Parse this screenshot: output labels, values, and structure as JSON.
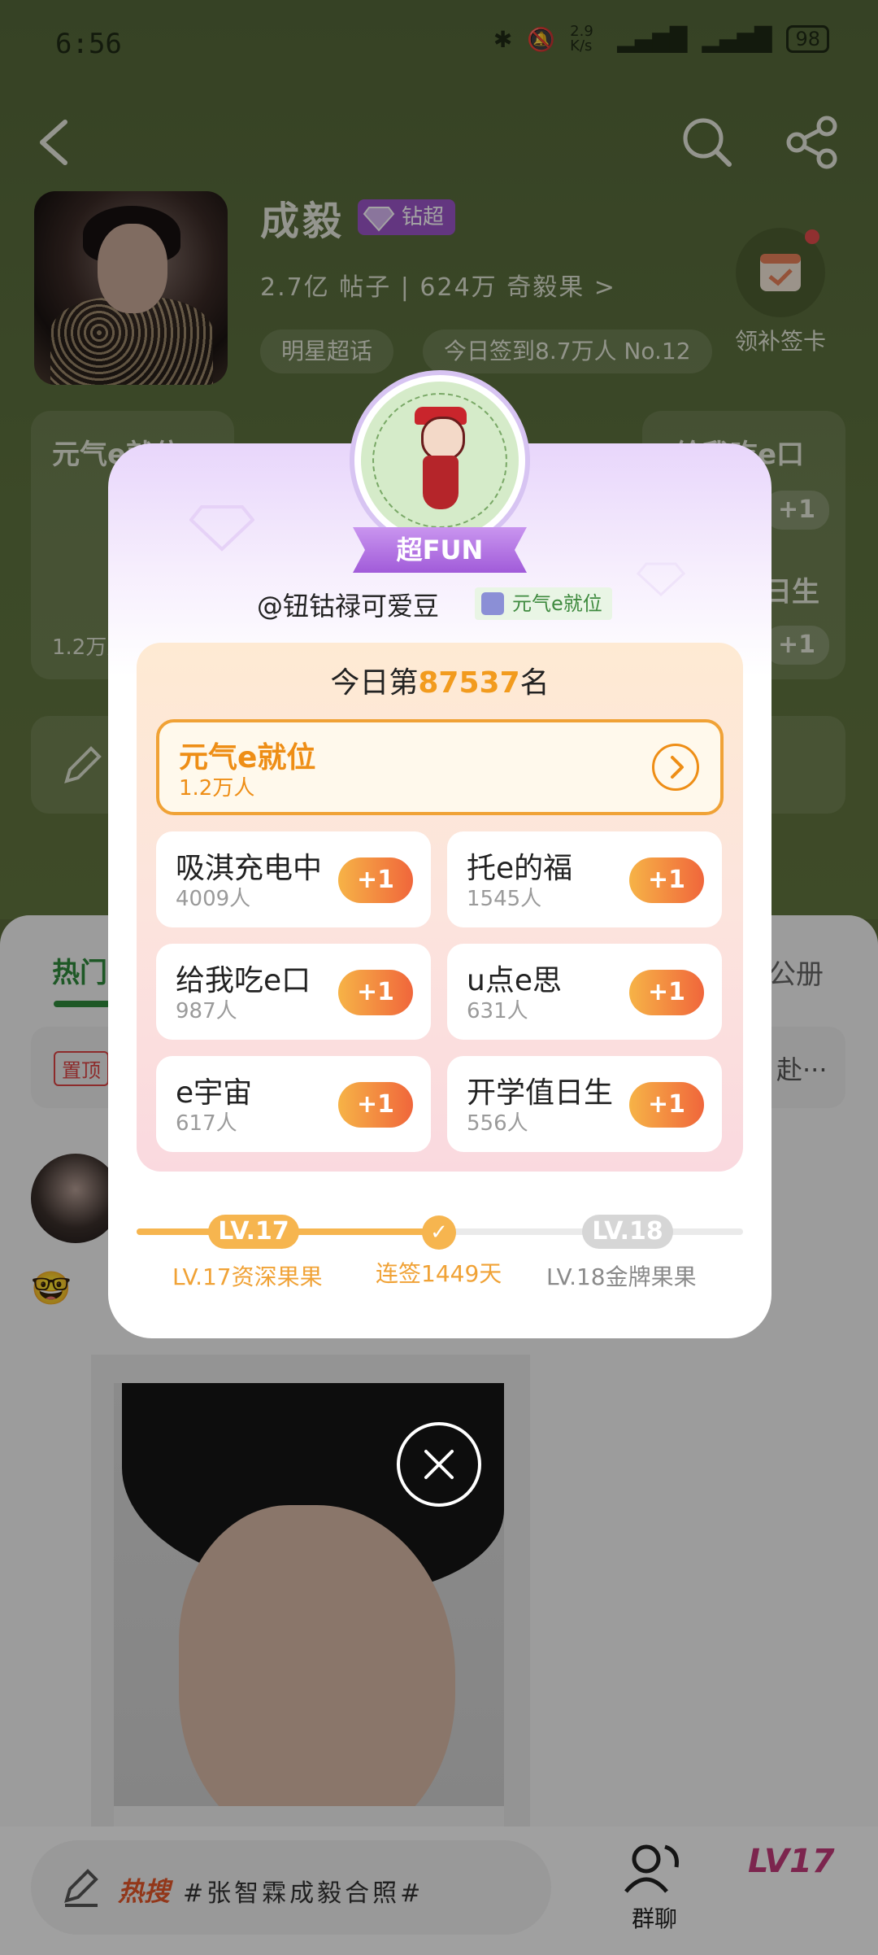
{
  "status_bar": {
    "time": "6:56",
    "net_speed": "2.9 K/s",
    "battery": "98"
  },
  "profile": {
    "name": "成毅",
    "badge": "钻超",
    "stats": "2.7亿 帖子 | 624万 奇毅果 >",
    "chip_1": "明星超话",
    "chip_2": "今日签到8.7万人 No.12",
    "checkin_label": "领补签卡"
  },
  "bg_panels": {
    "left_title": "元气e就位",
    "left_count": "1.2万人",
    "right_title": "给我吃e口",
    "right_title2": "日生",
    "plus": "+1"
  },
  "feed": {
    "tab_hot": "热门",
    "tab_right": "公册",
    "pin_label": "置顶",
    "pin_right": "赴···"
  },
  "bottom_bar": {
    "hot_label": "热搜",
    "hot_text": "#张智霖成毅合照#",
    "group_chat": "群聊",
    "level_badge": "LV17"
  },
  "modal": {
    "pendant_badge": "超FUN",
    "handle": "@钮钴禄可爱豆",
    "role_tag": "元气e就位",
    "rank_prefix": "今日第",
    "rank_num": "87537",
    "rank_suffix": "名",
    "top_item": {
      "name": "元气e就位",
      "count": "1.2万人"
    },
    "items": [
      {
        "name": "吸淇充电中",
        "count": "4009人",
        "plus": "+1"
      },
      {
        "name": "托e的福",
        "count": "1545人",
        "plus": "+1"
      },
      {
        "name": "给我吃e口",
        "count": "987人",
        "plus": "+1"
      },
      {
        "name": "u点e思",
        "count": "631人",
        "plus": "+1"
      },
      {
        "name": "e宇宙",
        "count": "617人",
        "plus": "+1"
      },
      {
        "name": "开学值日生",
        "count": "556人",
        "plus": "+1"
      }
    ],
    "level": {
      "current_pill": "LV.17",
      "next_pill": "LV.18",
      "current_label": "LV.17资深果果",
      "streak_label": "连签1449天",
      "next_label": "LV.18金牌果果"
    }
  },
  "colors": {
    "accent_orange": "#f29b1e",
    "super_purple": "#a15bd9",
    "bg_green": "#5f733f"
  }
}
